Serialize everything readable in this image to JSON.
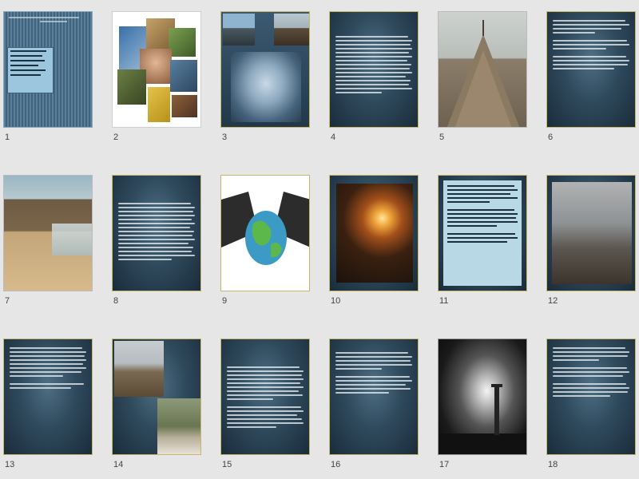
{
  "view": "slide-sorter",
  "slides": [
    {
      "number": "1",
      "kind": "title-bars"
    },
    {
      "number": "2",
      "kind": "photo-collage"
    },
    {
      "number": "3",
      "kind": "photo-grid"
    },
    {
      "number": "4",
      "kind": "text"
    },
    {
      "number": "5",
      "kind": "photo"
    },
    {
      "number": "6",
      "kind": "text"
    },
    {
      "number": "7",
      "kind": "photo"
    },
    {
      "number": "8",
      "kind": "text"
    },
    {
      "number": "9",
      "kind": "photo-handshake"
    },
    {
      "number": "10",
      "kind": "photo-fire"
    },
    {
      "number": "11",
      "kind": "text-light"
    },
    {
      "number": "12",
      "kind": "photo"
    },
    {
      "number": "13",
      "kind": "text"
    },
    {
      "number": "14",
      "kind": "photo-pair"
    },
    {
      "number": "15",
      "kind": "text"
    },
    {
      "number": "16",
      "kind": "text"
    },
    {
      "number": "17",
      "kind": "photo-explosion"
    },
    {
      "number": "18",
      "kind": "text"
    }
  ],
  "colors": {
    "slide_background": "#2f4a5d",
    "slide_border": "#c8b86a",
    "window_background": "#e6e6e6"
  }
}
